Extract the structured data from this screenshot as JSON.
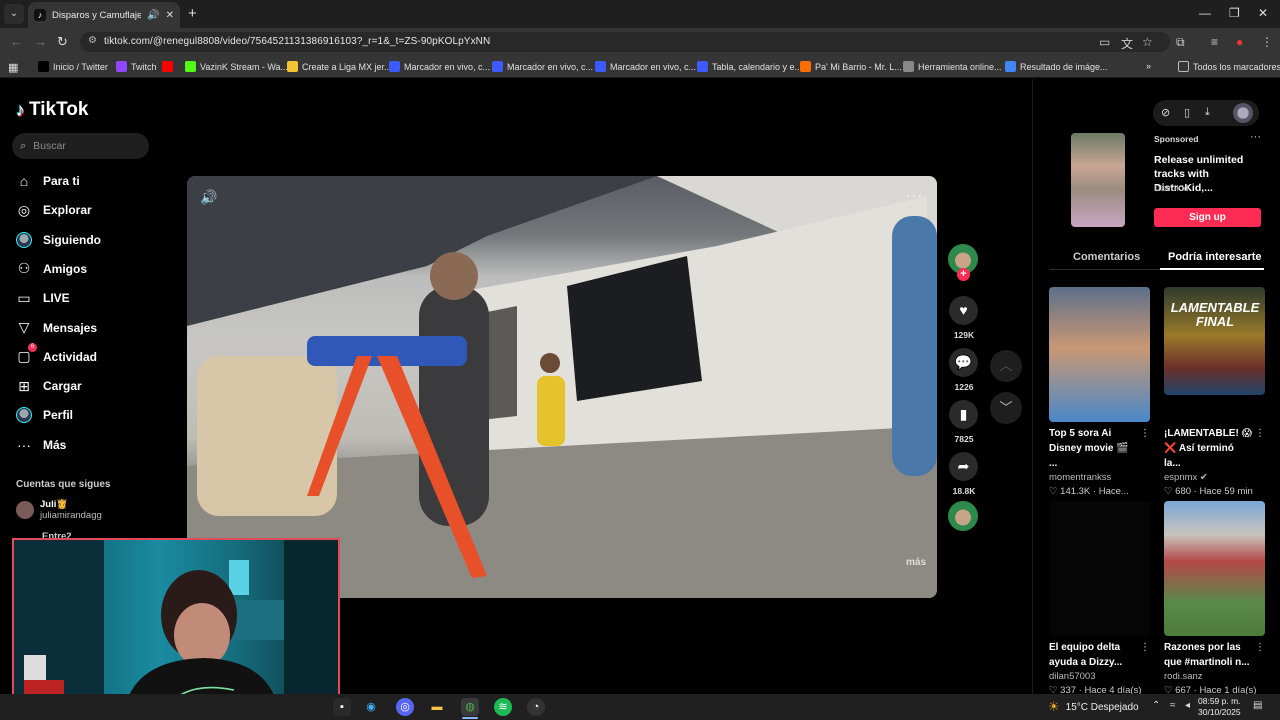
{
  "browser": {
    "tab_title": "Disparos y Camuflajes: Con",
    "url": "tiktok.com/@renegul8808/video/7564521131386916103?_r=1&_t=ZS-90pKOLpYxNN",
    "bookmarks": [
      {
        "label": "Inicio / Twitter",
        "icon": "x-logo",
        "color": "#000000"
      },
      {
        "label": "Twitch",
        "icon": "twitch-logo",
        "color": "#9146ff"
      },
      {
        "label": "",
        "icon": "youtube-logo",
        "color": "#ff0000"
      },
      {
        "label": "VazinK Stream - Wa...",
        "icon": "kick-logo",
        "color": "#53fc18"
      },
      {
        "label": "Create a Liga MX jer...",
        "icon": "bookmark-icon",
        "color": "#f4c430"
      },
      {
        "label": "Marcador en vivo, c...",
        "icon": "site-icon",
        "color": "#3d5afe"
      },
      {
        "label": "Marcador en vivo, c...",
        "icon": "site-icon",
        "color": "#3d5afe"
      },
      {
        "label": "Marcador en vivo, c...",
        "icon": "site-icon",
        "color": "#3d5afe"
      },
      {
        "label": "Tabla, calendario y e...",
        "icon": "site-icon",
        "color": "#3d5afe"
      },
      {
        "label": "Pa' Mi Barrio - Mr. L...",
        "icon": "site-icon",
        "color": "#ff6d00"
      },
      {
        "label": "Herramienta online...",
        "icon": "globe-icon",
        "color": "#888888"
      },
      {
        "label": "Resultado de imáge...",
        "icon": "google-icon",
        "color": "#4285f4"
      }
    ],
    "all_bookmarks": "Todos los marcadores"
  },
  "tiktok": {
    "logo_text": "TikTok",
    "search_placeholder": "Buscar",
    "nav": [
      {
        "label": "Para ti",
        "icon": "home-icon"
      },
      {
        "label": "Explorar",
        "icon": "compass-icon"
      },
      {
        "label": "Siguiendo",
        "icon": "following-avatar-icon"
      },
      {
        "label": "Amigos",
        "icon": "friends-icon"
      },
      {
        "label": "LIVE",
        "icon": "live-icon"
      },
      {
        "label": "Mensajes",
        "icon": "messages-icon"
      },
      {
        "label": "Actividad",
        "icon": "activity-icon",
        "badge": "6"
      },
      {
        "label": "Cargar",
        "icon": "upload-icon"
      },
      {
        "label": "Perfil",
        "icon": "profile-avatar-icon"
      },
      {
        "label": "Más",
        "icon": "more-icon"
      }
    ],
    "following_header": "Cuentas que sigues",
    "following": [
      {
        "name": "Juli👸",
        "handle": "juliamirandagg"
      },
      {
        "name": "Entre2",
        "handle": ""
      }
    ]
  },
  "video": {
    "more_label": "más",
    "likes": "129K",
    "comments": "1226",
    "saves": "7825",
    "shares": "18.8K"
  },
  "right_panel": {
    "ad": {
      "sponsored": "Sponsored",
      "title": "Release unlimited tracks with DistroKid,...",
      "brand": "DistroKid",
      "cta": "Sign up"
    },
    "tabs": [
      "Comentarios",
      "Podría interesarte"
    ],
    "cards": [
      {
        "title": "Top 5 sora Ai Disney movie 🎬 ...",
        "user": "momentrankss",
        "meta": "♡ 141.3K · Hace..."
      },
      {
        "title": "¡LAMENTABLE! 😱 ❌ Así terminó la...",
        "user": "espnmx ✔",
        "meta": "♡ 680 · Hace 59 min",
        "thumb_text": "LAMENTABLE FINAL"
      },
      {
        "title": "El equipo delta ayuda a Dizzy...",
        "user": "dilan57003",
        "meta": "♡ 337 · Hace 4 día(s)"
      },
      {
        "title": "Razones por las que #martinoli n...",
        "user": "rodi.sanz",
        "meta": "♡ 667 · Hace 1 día(s)"
      }
    ]
  },
  "taskbar": {
    "weather": "15°C  Despejado",
    "time": "08:59 p. m.",
    "date": "30/10/2025"
  }
}
